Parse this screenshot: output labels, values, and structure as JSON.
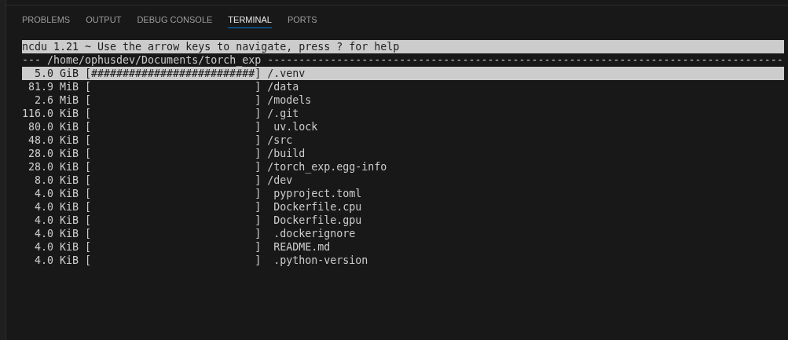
{
  "tabs": [
    {
      "label": "PROBLEMS",
      "selected": false
    },
    {
      "label": "OUTPUT",
      "selected": false
    },
    {
      "label": "DEBUG CONSOLE",
      "selected": false
    },
    {
      "label": "TERMINAL",
      "selected": true
    },
    {
      "label": "PORTS",
      "selected": false
    }
  ],
  "terminal": {
    "help_line": "ncdu 1.21 ~ Use the arrow keys to navigate, press ? for help",
    "path_line": "--- /home/ophusdev/Documents/torch_exp ----------------------------------------------------------------------------------",
    "rows": [
      {
        "size": "5.0 GiB",
        "bar": "[##########################]",
        "name": "/.venv",
        "kind": "dir",
        "selected": true
      },
      {
        "size": "81.9 MiB",
        "bar": "[                          ]",
        "name": "/data",
        "kind": "dir",
        "selected": false
      },
      {
        "size": "2.6 MiB",
        "bar": "[                          ]",
        "name": "/models",
        "kind": "dir",
        "selected": false
      },
      {
        "size": "116.0 KiB",
        "bar": "[                          ]",
        "name": "/.git",
        "kind": "dir",
        "selected": false
      },
      {
        "size": "80.0 KiB",
        "bar": "[                          ]",
        "name": "uv.lock",
        "kind": "file",
        "selected": false
      },
      {
        "size": "48.0 KiB",
        "bar": "[                          ]",
        "name": "/src",
        "kind": "dir",
        "selected": false
      },
      {
        "size": "28.0 KiB",
        "bar": "[                          ]",
        "name": "/build",
        "kind": "dir",
        "selected": false
      },
      {
        "size": "28.0 KiB",
        "bar": "[                          ]",
        "name": "/torch_exp.egg-info",
        "kind": "dir",
        "selected": false
      },
      {
        "size": "8.0 KiB",
        "bar": "[                          ]",
        "name": "/dev",
        "kind": "dir",
        "selected": false
      },
      {
        "size": "4.0 KiB",
        "bar": "[                          ]",
        "name": "pyproject.toml",
        "kind": "file",
        "selected": false
      },
      {
        "size": "4.0 KiB",
        "bar": "[                          ]",
        "name": "Dockerfile.cpu",
        "kind": "file",
        "selected": false
      },
      {
        "size": "4.0 KiB",
        "bar": "[                          ]",
        "name": "Dockerfile.gpu",
        "kind": "file",
        "selected": false
      },
      {
        "size": "4.0 KiB",
        "bar": "[                          ]",
        "name": ".dockerignore",
        "kind": "file",
        "selected": false
      },
      {
        "size": "4.0 KiB",
        "bar": "[                          ]",
        "name": "README.md",
        "kind": "file",
        "selected": false
      },
      {
        "size": "4.0 KiB",
        "bar": "[                          ]",
        "name": ".python-version",
        "kind": "file",
        "selected": false
      }
    ]
  }
}
